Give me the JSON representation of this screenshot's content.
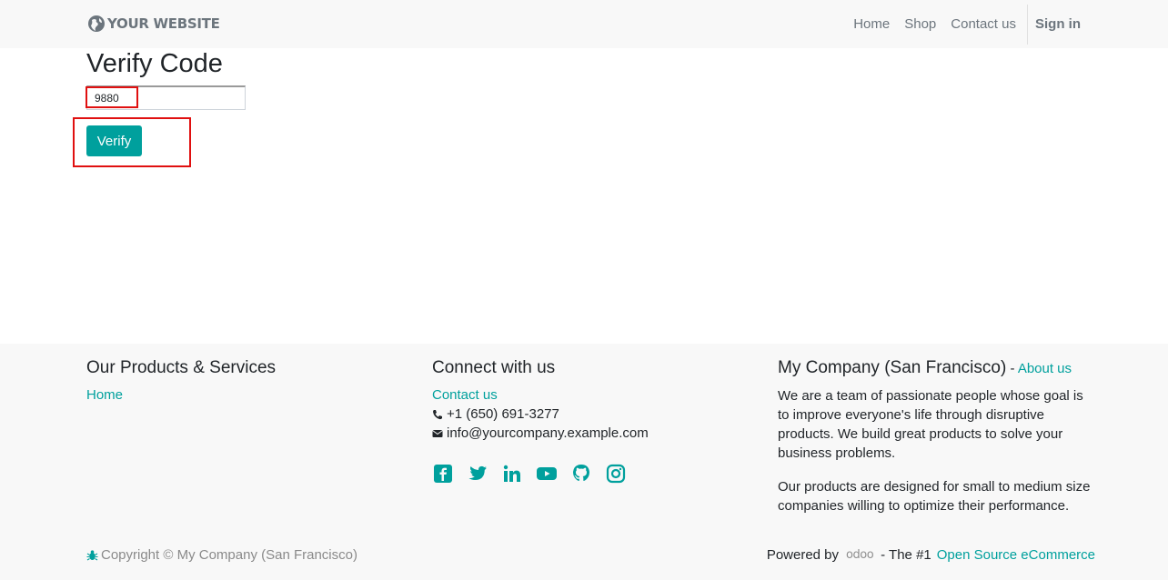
{
  "header": {
    "logo_text": "YOUR WEBSITE",
    "nav": {
      "home": "Home",
      "shop": "Shop",
      "contact": "Contact us",
      "signin": "Sign in"
    }
  },
  "main": {
    "title": "Verify Code",
    "code_value": "9880",
    "verify_label": "Verify"
  },
  "footer": {
    "products": {
      "heading": "Our Products & Services",
      "link_home": "Home"
    },
    "connect": {
      "heading": "Connect with us",
      "contact_link": "Contact us",
      "phone": "+1 (650) 691-3277",
      "email": "info@yourcompany.example.com",
      "social_icons": [
        "facebook-icon",
        "twitter-icon",
        "linkedin-icon",
        "youtube-icon",
        "github-icon",
        "instagram-icon"
      ]
    },
    "company": {
      "heading": "My Company (San Francisco)",
      "separator": " - ",
      "about_link": "About us",
      "para1": "We are a team of passionate people whose goal is to improve everyone's life through disruptive products. We build great products to solve your business problems.",
      "para2": "Our products are designed for small to medium size companies willing to optimize their performance."
    },
    "copyright": "Copyright © My Company (San Francisco)",
    "powered_by": "Powered by",
    "odoo": "odoo",
    "tagline": "- The #1",
    "ecommerce_link": "Open Source eCommerce"
  },
  "colors": {
    "accent": "#00a09d",
    "highlight": "#e01010",
    "header_bg": "#f8f8f8"
  }
}
